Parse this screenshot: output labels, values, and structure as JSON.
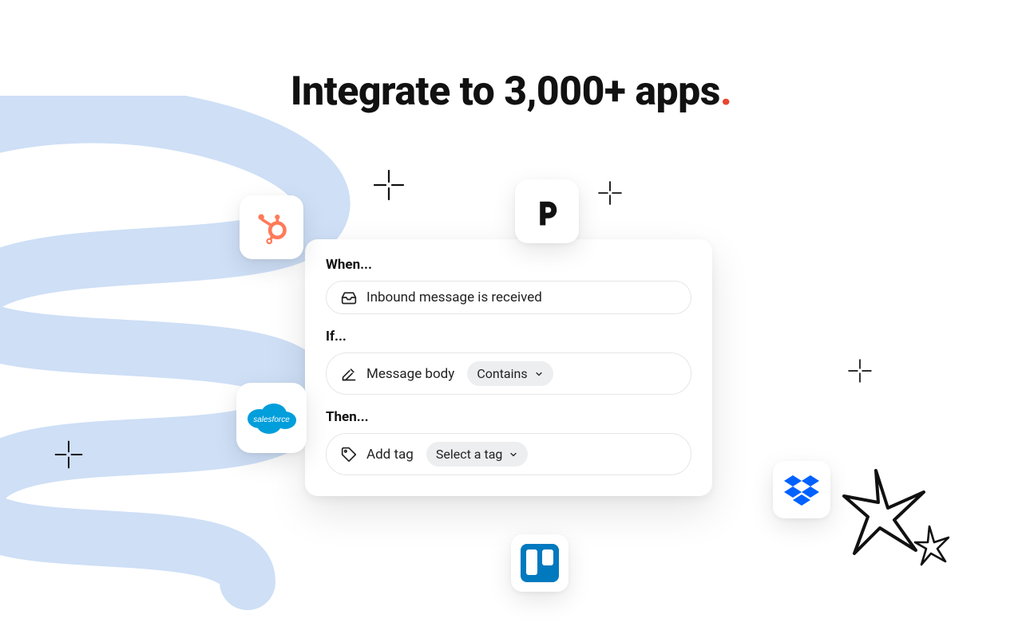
{
  "headline": {
    "text": "Integrate to 3,000+ apps",
    "punct": "."
  },
  "rule": {
    "when_label": "When...",
    "when_value": "Inbound message is received",
    "if_label": "If...",
    "if_field": "Message body",
    "if_operator": "Contains",
    "then_label": "Then...",
    "then_action": "Add tag",
    "then_select": "Select a tag"
  },
  "apps": {
    "hubspot": {
      "name": "HubSpot",
      "color": "#ff7a59"
    },
    "pipedrive": {
      "name": "Pipedrive",
      "color": "#111111"
    },
    "salesforce": {
      "name": "Salesforce",
      "color": "#009edb"
    },
    "dropbox": {
      "name": "Dropbox",
      "color": "#0061ff"
    },
    "trello": {
      "name": "Trello",
      "color": "#0079bf"
    }
  },
  "accent": "#e9452f"
}
